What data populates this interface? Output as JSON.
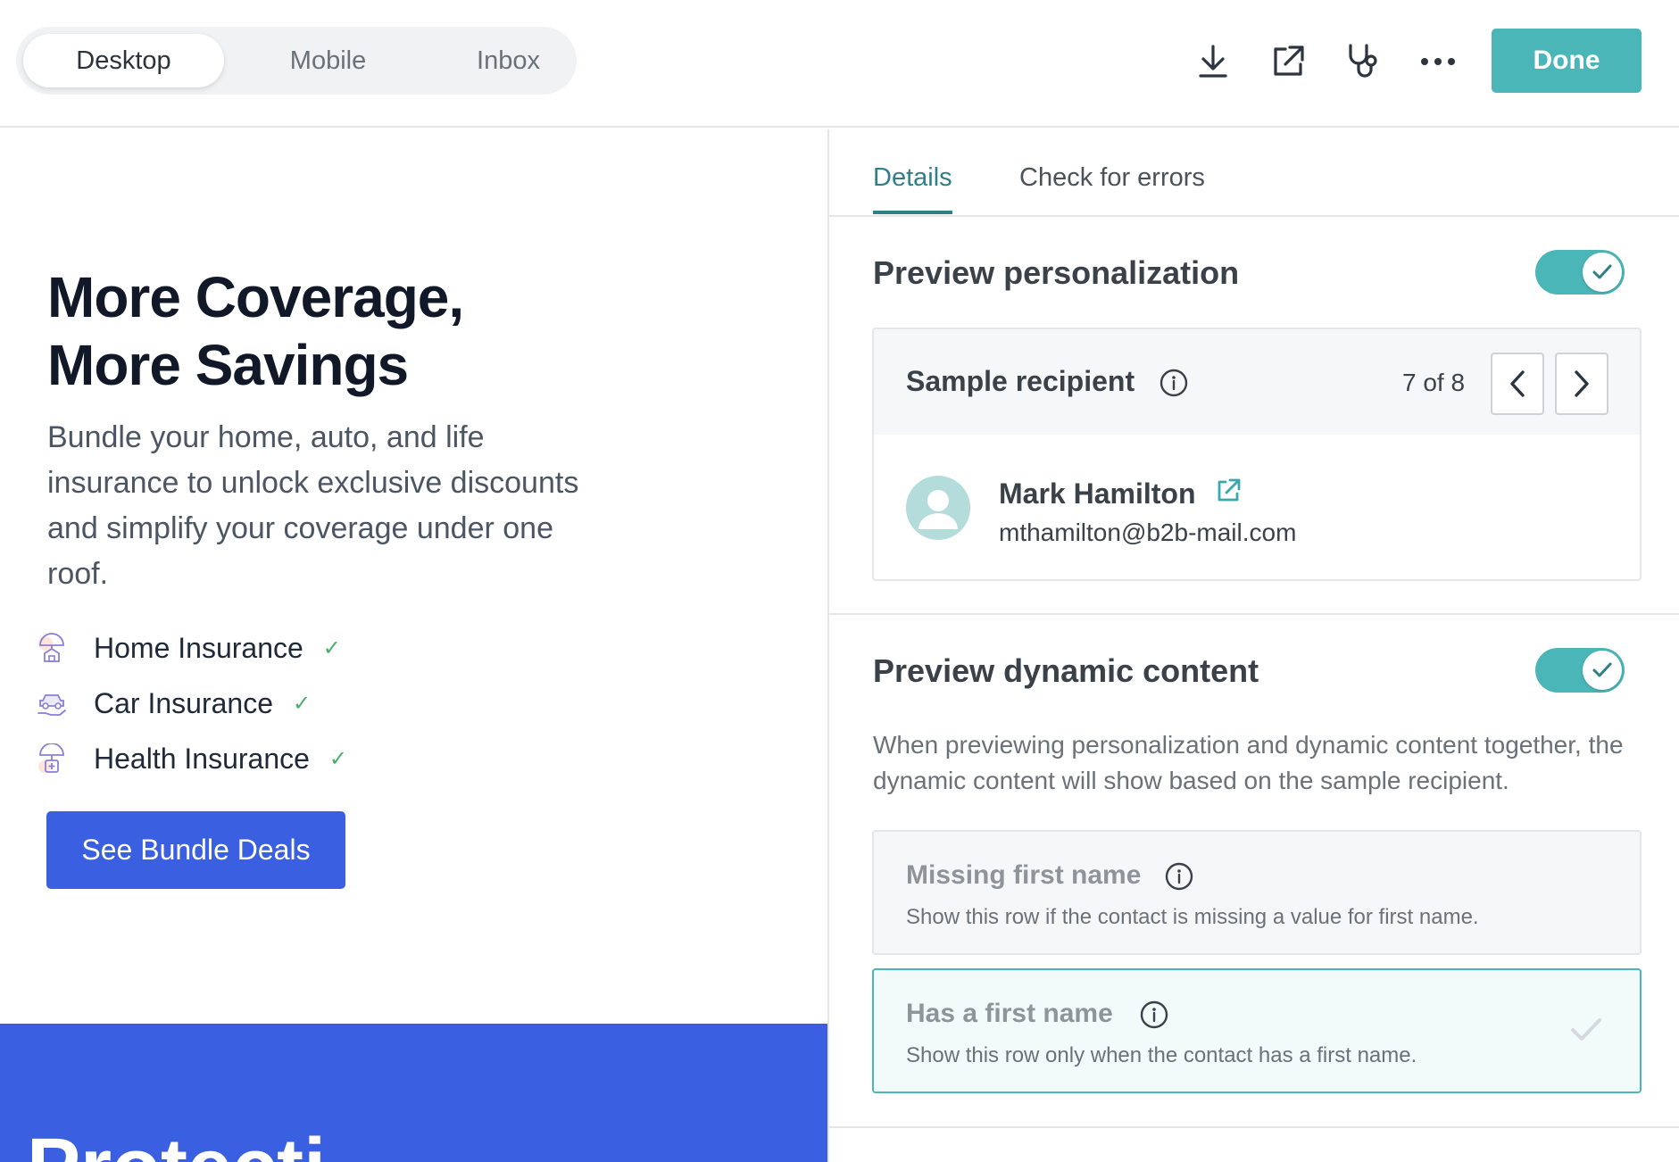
{
  "view_switch": {
    "tabs": [
      "Desktop",
      "Mobile",
      "Inbox"
    ],
    "active": "Desktop"
  },
  "toolbar": {
    "icons": [
      "download-icon",
      "external-link-icon",
      "stethoscope-icon",
      "more-icon"
    ],
    "done_label": "Done"
  },
  "colors": {
    "accent": "#4bb6b8",
    "accent_dark": "#2f7f88",
    "cta_blue": "#3a5fe0"
  },
  "email_preview": {
    "headline": "More Coverage, More Savings",
    "headline_line1": "More Coverage,",
    "headline_line2": "More Savings",
    "body": "Bundle your home, auto, and life insurance to unlock exclusive discounts and simplify your coverage under one roof.",
    "items": [
      {
        "label": "Home Insurance",
        "icon": "home-umbrella-icon",
        "check": "✓"
      },
      {
        "label": "Car Insurance",
        "icon": "car-hand-icon",
        "check": "✓"
      },
      {
        "label": "Health Insurance",
        "icon": "health-umbrella-icon",
        "check": "✓"
      }
    ],
    "cta_label": "See Bundle Deals",
    "band_text": "Protecti"
  },
  "panel": {
    "tabs": [
      "Details",
      "Check for errors"
    ],
    "active_tab": "Details",
    "personalization": {
      "title": "Preview personalization",
      "enabled": true,
      "sample_recipient_label": "Sample recipient",
      "count": "7 of 8",
      "recipient_name": "Mark Hamilton",
      "recipient_email": "mthamilton@b2b-mail.com"
    },
    "dynamic": {
      "title": "Preview dynamic content",
      "enabled": true,
      "description": "When previewing personalization and dynamic content together, the dynamic content will show based on the sample recipient.",
      "options": [
        {
          "title": "Missing first name",
          "desc": "Show this row if the contact is missing a value for first name.",
          "selected": false
        },
        {
          "title": "Has a first name",
          "desc": "Show this row only when the contact has a first name.",
          "selected": true
        }
      ]
    }
  }
}
